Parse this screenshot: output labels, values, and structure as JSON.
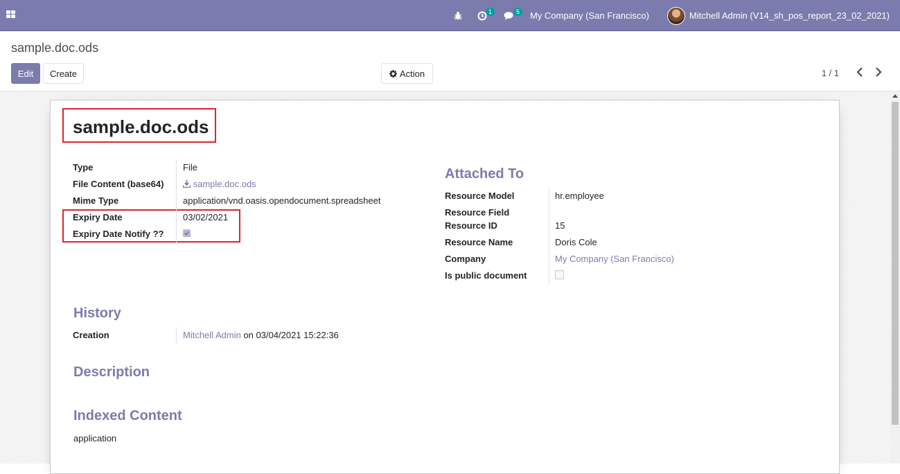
{
  "navbar": {
    "debug_icon": "bug-icon",
    "activity_badge": "1",
    "messages_badge": "5",
    "company": "My Company (San Francisco)",
    "user": "Mitchell Admin (V14_sh_pos_report_23_02_2021)"
  },
  "control_panel": {
    "breadcrumb": "sample.doc.ods",
    "edit_label": "Edit",
    "create_label": "Create",
    "action_label": "Action",
    "pager": "1 / 1"
  },
  "record": {
    "title": "sample.doc.ods",
    "left_fields": {
      "type_label": "Type",
      "type_value": "File",
      "content_label": "File Content (base64)",
      "content_value": "sample.doc.ods",
      "mime_label": "Mime Type",
      "mime_value": "application/vnd.oasis.opendocument.spreadsheet",
      "expiry_label": "Expiry Date",
      "expiry_value": "03/02/2021",
      "notify_label": "Expiry Date Notify ??",
      "notify_checked": true
    },
    "attached_to": {
      "heading": "Attached To",
      "model_label": "Resource Model",
      "model_value": "hr.employee",
      "field_label": "Resource Field",
      "field_value": "",
      "id_label": "Resource ID",
      "id_value": "15",
      "name_label": "Resource Name",
      "name_value": "Doris Cole",
      "company_label": "Company",
      "company_value": "My Company (San Francisco)",
      "public_label": "Is public document",
      "public_checked": false
    },
    "history": {
      "heading": "History",
      "creation_label": "Creation",
      "creation_user": "Mitchell Admin",
      "creation_on": "on 03/04/2021 15:22:36"
    },
    "description": {
      "heading": "Description"
    },
    "indexed": {
      "heading": "Indexed Content",
      "value": "application"
    }
  },
  "colors": {
    "brand": "#7c7bad",
    "highlight": "#d9252b"
  }
}
